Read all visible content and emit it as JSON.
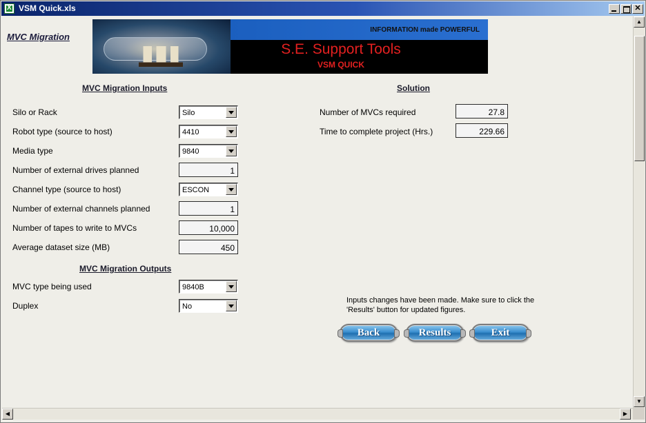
{
  "window": {
    "title": "VSM Quick.xls"
  },
  "sheet_title": "MVC Migration",
  "banner": {
    "tagline": "INFORMATION made POWERFUL",
    "title": "S.E. Support Tools",
    "subtitle": "VSM QUICK"
  },
  "inputs": {
    "heading": "MVC Migration Inputs",
    "silo_or_rack": {
      "label": "Silo or Rack",
      "value": "Silo"
    },
    "robot_type": {
      "label": "Robot type (source to host)",
      "value": "4410"
    },
    "media_type": {
      "label": "Media type",
      "value": "9840"
    },
    "external_drives": {
      "label": "Number of external drives planned",
      "value": "1"
    },
    "channel_type": {
      "label": "Channel type (source to host)",
      "value": "ESCON"
    },
    "external_channels": {
      "label": "Number of external channels planned",
      "value": "1"
    },
    "tapes_to_write": {
      "label": "Number of tapes to write to MVCs",
      "value": "10,000"
    },
    "dataset_size": {
      "label": "Average dataset size (MB)",
      "value": "450"
    }
  },
  "outputs": {
    "heading": "MVC Migration Outputs",
    "mvc_type": {
      "label": "MVC type being used",
      "value": "9840B"
    },
    "duplex": {
      "label": "Duplex",
      "value": "No"
    }
  },
  "solution": {
    "heading": "Solution",
    "mvcs_required": {
      "label": "Number of MVCs required",
      "value": "27.8"
    },
    "time_to_complete": {
      "label": "Time to complete project (Hrs.)",
      "value": "229.66"
    }
  },
  "notice": "Inputs changes have been made. Make sure to click the 'Results' button for updated figures.",
  "buttons": {
    "back": "Back",
    "results": "Results",
    "exit": "Exit"
  }
}
